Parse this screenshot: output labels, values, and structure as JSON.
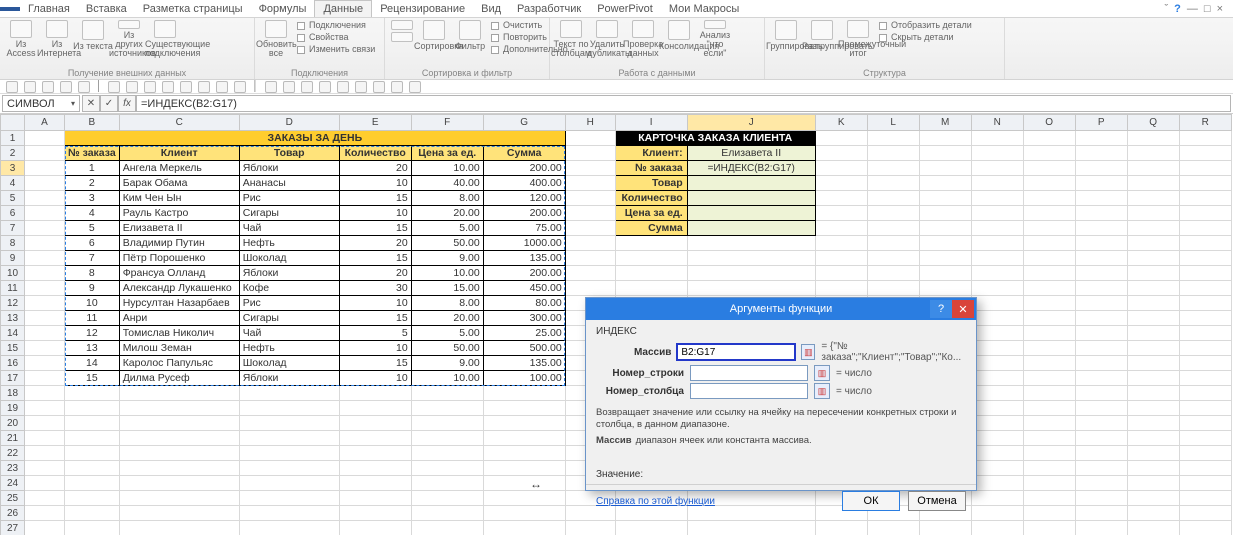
{
  "tabs": {
    "file": "",
    "items": [
      "Главная",
      "Вставка",
      "Разметка страницы",
      "Формулы",
      "Данные",
      "Рецензирование",
      "Вид",
      "Разработчик",
      "PowerPivot",
      "Мои Макросы"
    ],
    "active": 4
  },
  "ribbon": {
    "g1_items": [
      "Из Access",
      "Из Интернета",
      "Из текста",
      "Из других источников",
      "Существующие подключения"
    ],
    "g1_label": "Получение внешних данных",
    "g2_btn": "Обновить все",
    "g2_items": [
      "Подключения",
      "Свойства",
      "Изменить связи"
    ],
    "g2_label": "Подключения",
    "g3_items": [
      "Сортировка",
      "Фильтр"
    ],
    "g3_sub": [
      "Очистить",
      "Повторить",
      "Дополнительно"
    ],
    "g3_label": "Сортировка и фильтр",
    "g4_items": [
      "Текст по столбцам",
      "Удалить дубликаты",
      "Проверка данных",
      "Консолидация",
      "Анализ \"что если\""
    ],
    "g4_label": "Работа с данными",
    "g5_items": [
      "Группировать",
      "Разгруппировать",
      "Промежуточный итог"
    ],
    "g5_sub": [
      "Отобразить детали",
      "Скрыть детали"
    ],
    "g5_label": "Структура"
  },
  "namebox": "СИМВОЛ",
  "formula": "=ИНДЕКС(B2:G17)",
  "columns": [
    "A",
    "B",
    "C",
    "D",
    "E",
    "F",
    "G",
    "H",
    "I",
    "J",
    "K",
    "L",
    "M",
    "N",
    "O",
    "P",
    "Q",
    "R"
  ],
  "orders": {
    "title": "ЗАКАЗЫ ЗА ДЕНЬ",
    "headers": [
      "№ заказа",
      "Клиент",
      "Товар",
      "Количество",
      "Цена за ед.",
      "Сумма"
    ],
    "rows": [
      [
        "1",
        "Ангела Меркель",
        "Яблоки",
        "20",
        "10.00",
        "200.00"
      ],
      [
        "2",
        "Барак Обама",
        "Ананасы",
        "10",
        "40.00",
        "400.00"
      ],
      [
        "3",
        "Ким Чен Ын",
        "Рис",
        "15",
        "8.00",
        "120.00"
      ],
      [
        "4",
        "Рауль Кастро",
        "Сигары",
        "10",
        "20.00",
        "200.00"
      ],
      [
        "5",
        "Елизавета II",
        "Чай",
        "15",
        "5.00",
        "75.00"
      ],
      [
        "6",
        "Владимир Путин",
        "Нефть",
        "20",
        "50.00",
        "1000.00"
      ],
      [
        "7",
        "Пётр Порошенко",
        "Шоколад",
        "15",
        "9.00",
        "135.00"
      ],
      [
        "8",
        "Франсуа Олланд",
        "Яблоки",
        "20",
        "10.00",
        "200.00"
      ],
      [
        "9",
        "Александр Лукашенко",
        "Кофе",
        "30",
        "15.00",
        "450.00"
      ],
      [
        "10",
        "Нурсултан Назарбаев",
        "Рис",
        "10",
        "8.00",
        "80.00"
      ],
      [
        "11",
        "Анри",
        "Сигары",
        "15",
        "20.00",
        "300.00"
      ],
      [
        "12",
        "Томислав Николич",
        "Чай",
        "5",
        "5.00",
        "25.00"
      ],
      [
        "13",
        "Милош Земан",
        "Нефть",
        "10",
        "50.00",
        "500.00"
      ],
      [
        "14",
        "Каролос Папульяс",
        "Шоколад",
        "15",
        "9.00",
        "135.00"
      ],
      [
        "15",
        "Дилма Русеф",
        "Яблоки",
        "10",
        "10.00",
        "100.00"
      ]
    ]
  },
  "card": {
    "title": "КАРТОЧКА ЗАКАЗА КЛИЕНТА",
    "rows": [
      [
        "Клиент:",
        "Елизавета II"
      ],
      [
        "№ заказа",
        "=ИНДЕКС(B2:G17)"
      ],
      [
        "Товар",
        ""
      ],
      [
        "Количество",
        ""
      ],
      [
        "Цена за ед.",
        ""
      ],
      [
        "Сумма",
        ""
      ]
    ]
  },
  "dialog": {
    "title": "Аргументы функции",
    "func": "ИНДЕКС",
    "rows": [
      {
        "label": "Массив",
        "value": "B2:G17",
        "result": "= {\"№ заказа\";\"Клиент\";\"Товар\";\"Ко...",
        "hl": true
      },
      {
        "label": "Номер_строки",
        "value": "",
        "result": "= число",
        "hl": false
      },
      {
        "label": "Номер_столбца",
        "value": "",
        "result": "= число",
        "hl": false
      }
    ],
    "desc": "Возвращает значение или ссылку на ячейку на пересечении конкретных строки и столбца, в данном диапазоне.",
    "arg_label": "Массив",
    "arg_desc": "диапазон ячеек или константа массива.",
    "value_label": "Значение:",
    "help_link": "Справка по этой функции",
    "ok": "ОК",
    "cancel": "Отмена"
  }
}
